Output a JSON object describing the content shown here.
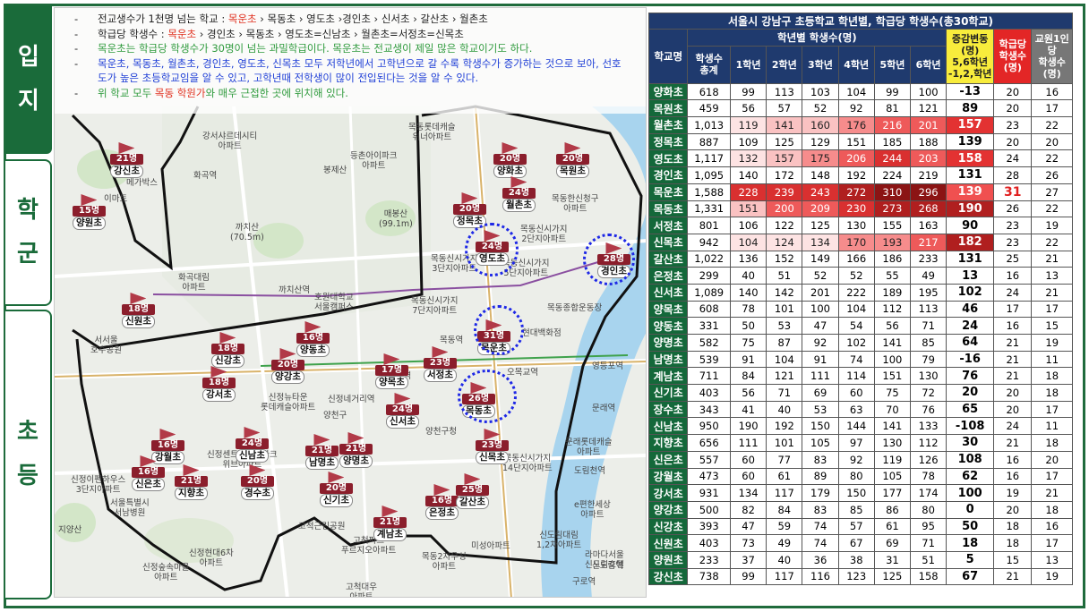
{
  "tabs": [
    {
      "label": "입지",
      "active": true
    },
    {
      "label": "학군",
      "active": false
    },
    {
      "label": "초등",
      "active": false
    }
  ],
  "notes": [
    {
      "parts": [
        {
          "t": "전교생수가 1천명 넘는 학교 : ",
          "c": ""
        },
        {
          "t": "목운초",
          "c": "red"
        },
        {
          "t": " › 목동초 › 영도초 ›경인초 › 신서초 › 갈산초 › 월촌초",
          "c": ""
        }
      ]
    },
    {
      "parts": [
        {
          "t": "학급당 학생수 : ",
          "c": ""
        },
        {
          "t": "목운초",
          "c": "red"
        },
        {
          "t": " › 경인초 › 목동초 › 영도초=신남초 › 월촌초=서정초=신목초",
          "c": ""
        }
      ]
    },
    {
      "parts": [
        {
          "t": "목운초는 학급당 학생수가 30명이 넘는 과밀학급이다. 목운초는 전교생이 제일 많은 학교이기도 하다.",
          "c": "green"
        }
      ]
    },
    {
      "parts": [
        {
          "t": "목운초, 목동초, 월촌초, 경인초, 영도초, 신목초 모두 저학년에서 고학년으로 갈 수록 학생수가 증가하는 것으로 보아, 선호",
          "c": "blue"
        }
      ]
    },
    {
      "parts": [
        {
          "t": "도가 높은 초등학교임을 알 수 있고, 고학년때 전학생이 많이 전입된다는 것을 알 수 있다.",
          "c": "blue"
        }
      ]
    },
    {
      "parts": [
        {
          "t": "위 학교 모두 ",
          "c": "green"
        },
        {
          "t": "목동 학원가",
          "c": "red"
        },
        {
          "t": "와 매우 근접한 곳에 위치해 있다.",
          "c": "green"
        }
      ]
    }
  ],
  "map": {
    "schools": [
      {
        "count": "21명",
        "name": "강신초"
      },
      {
        "count": "15명",
        "name": "양원초"
      },
      {
        "count": "20명",
        "name": "양화초"
      },
      {
        "count": "20명",
        "name": "목원초"
      },
      {
        "count": "24명",
        "name": "월촌초"
      },
      {
        "count": "20명",
        "name": "정목초"
      },
      {
        "count": "24명",
        "name": "영도초"
      },
      {
        "count": "28명",
        "name": "경인초"
      },
      {
        "count": "18명",
        "name": "신원초"
      },
      {
        "count": "18명",
        "name": "신강초"
      },
      {
        "count": "20명",
        "name": "양강초"
      },
      {
        "count": "16명",
        "name": "양동초"
      },
      {
        "count": "31명",
        "name": "목운초"
      },
      {
        "count": "18명",
        "name": "강서초"
      },
      {
        "count": "17명",
        "name": "양목초"
      },
      {
        "count": "23명",
        "name": "서정초"
      },
      {
        "count": "26명",
        "name": "목동초"
      },
      {
        "count": "24명",
        "name": "신서초"
      },
      {
        "count": "16명",
        "name": "강월초"
      },
      {
        "count": "24명",
        "name": "신남초"
      },
      {
        "count": "21명",
        "name": "남명초"
      },
      {
        "count": "21명",
        "name": "양명초"
      },
      {
        "count": "16명",
        "name": "신은초"
      },
      {
        "count": "21명",
        "name": "지향초"
      },
      {
        "count": "20명",
        "name": "경수초"
      },
      {
        "count": "20명",
        "name": "신기초"
      },
      {
        "count": "23명",
        "name": "신목초"
      },
      {
        "count": "16명",
        "name": "은정초"
      },
      {
        "count": "25명",
        "name": "갈산초"
      },
      {
        "count": "21명",
        "name": "계남초"
      }
    ],
    "places": [
      {
        "text": "강서샤르데시티\n아파트"
      },
      {
        "text": "목동롯데캐슬\n위너아파트"
      },
      {
        "text": "등촌아이파크\n아파트"
      },
      {
        "text": "화곡역"
      },
      {
        "text": "봉제산"
      },
      {
        "text": "메가박스"
      },
      {
        "text": "이마트"
      },
      {
        "text": "목동한신청구\n아파트"
      },
      {
        "text": "매봉산\n(99.1m)"
      },
      {
        "text": "까치산\n(70.5m)"
      },
      {
        "text": "목동신시가지\n2단지아파트"
      },
      {
        "text": "목동신시가지\n3단지아파트"
      },
      {
        "text": "목동신시가지\n5단지아파트"
      },
      {
        "text": "화곡대림\n아파트"
      },
      {
        "text": "까치산역"
      },
      {
        "text": "호원대학교\n서울캠퍼스"
      },
      {
        "text": "목동종합운동장"
      },
      {
        "text": "목동신시가지\n7단지아파트"
      },
      {
        "text": "목동역"
      },
      {
        "text": "현대백화점"
      },
      {
        "text": "오목교역"
      },
      {
        "text": "신정역"
      },
      {
        "text": "양천구"
      },
      {
        "text": "신정뉴타운\n롯데캐슬아파트"
      },
      {
        "text": "신정네거리역"
      },
      {
        "text": "양천구청"
      },
      {
        "text": "목동신시가지\n14단지아파트"
      },
      {
        "text": "문래롯데캐슬\n아파트"
      },
      {
        "text": "문래역"
      },
      {
        "text": "도림천역"
      },
      {
        "text": "신정센트럴아이파크\n위브아파트"
      },
      {
        "text": "신정이펜하우스\n3단지아파트"
      },
      {
        "text": "서울특별시\n서남병원"
      },
      {
        "text": "지양산"
      },
      {
        "text": "고척근린공원"
      },
      {
        "text": "고척파크\n푸르지오아파트"
      },
      {
        "text": "신정현대6차\n아파트"
      },
      {
        "text": "신정숲속마을\n아파트"
      },
      {
        "text": "목동2차우성\n아파트"
      },
      {
        "text": "미성아파트"
      },
      {
        "text": "구로역"
      },
      {
        "text": "신도림대림\n1,2차아파트"
      },
      {
        "text": "라마다서울\n신도림호텔"
      },
      {
        "text": "신도림역"
      },
      {
        "text": "고척대우\n아파트"
      },
      {
        "text": "e편한세상\n아파트"
      },
      {
        "text": "서서울\n호수공원"
      },
      {
        "text": "영등포역"
      }
    ]
  },
  "table": {
    "title": "서울시 강남구 초등학교 학년별, 학급당 학생수(총30학교)",
    "headers": {
      "school": "학교명",
      "grade_group": "학년별 학생수(명)",
      "total": "학생수\n총계",
      "grades": [
        "1학년",
        "2학년",
        "3학년",
        "4학년",
        "5학년",
        "6학년"
      ],
      "variation": "증감변동\n(명)\n5,6학년\n-1,2,학년",
      "per_class": "학급당\n학생수\n(명)",
      "per_teacher": "교원1인\n당\n학생수\n(명)"
    },
    "rows": [
      {
        "name": "양화초",
        "total": "618",
        "g": [
          "99",
          "113",
          "103",
          "104",
          "99",
          "100"
        ],
        "var": "-13",
        "cls": "20",
        "tch": "16"
      },
      {
        "name": "목원초",
        "total": "459",
        "g": [
          "56",
          "57",
          "52",
          "92",
          "81",
          "121"
        ],
        "var": "89",
        "cls": "20",
        "tch": "17"
      },
      {
        "name": "월촌초",
        "total": "1,013",
        "g": [
          "119",
          "141",
          "160",
          "176",
          "216",
          "201"
        ],
        "var": "157",
        "cls": "23",
        "tch": "22"
      },
      {
        "name": "정목초",
        "total": "887",
        "g": [
          "109",
          "125",
          "129",
          "151",
          "185",
          "188"
        ],
        "var": "139",
        "cls": "20",
        "tch": "20"
      },
      {
        "name": "영도초",
        "total": "1,117",
        "g": [
          "132",
          "157",
          "175",
          "206",
          "244",
          "203"
        ],
        "var": "158",
        "cls": "24",
        "tch": "22"
      },
      {
        "name": "경인초",
        "total": "1,095",
        "g": [
          "140",
          "172",
          "148",
          "192",
          "224",
          "219"
        ],
        "var": "131",
        "cls": "28",
        "tch": "26"
      },
      {
        "name": "목운초",
        "total": "1,588",
        "g": [
          "228",
          "239",
          "243",
          "272",
          "310",
          "296"
        ],
        "var": "139",
        "cls": "31",
        "tch": "27"
      },
      {
        "name": "목동초",
        "total": "1,331",
        "g": [
          "151",
          "200",
          "209",
          "230",
          "273",
          "268"
        ],
        "var": "190",
        "cls": "26",
        "tch": "22"
      },
      {
        "name": "서정초",
        "total": "801",
        "g": [
          "106",
          "122",
          "125",
          "130",
          "155",
          "163"
        ],
        "var": "90",
        "cls": "23",
        "tch": "19"
      },
      {
        "name": "신목초",
        "total": "942",
        "g": [
          "104",
          "124",
          "134",
          "170",
          "193",
          "217"
        ],
        "var": "182",
        "cls": "23",
        "tch": "22"
      },
      {
        "name": "갈산초",
        "total": "1,022",
        "g": [
          "136",
          "152",
          "149",
          "166",
          "186",
          "233"
        ],
        "var": "131",
        "cls": "25",
        "tch": "21"
      },
      {
        "name": "은정초",
        "total": "299",
        "g": [
          "40",
          "51",
          "52",
          "52",
          "55",
          "49"
        ],
        "var": "13",
        "cls": "16",
        "tch": "13"
      },
      {
        "name": "신서초",
        "total": "1,089",
        "g": [
          "140",
          "142",
          "201",
          "222",
          "189",
          "195"
        ],
        "var": "102",
        "cls": "24",
        "tch": "21"
      },
      {
        "name": "양목초",
        "total": "608",
        "g": [
          "78",
          "101",
          "100",
          "104",
          "112",
          "113"
        ],
        "var": "46",
        "cls": "17",
        "tch": "17"
      },
      {
        "name": "양동초",
        "total": "331",
        "g": [
          "50",
          "53",
          "47",
          "54",
          "56",
          "71"
        ],
        "var": "24",
        "cls": "16",
        "tch": "15"
      },
      {
        "name": "양명초",
        "total": "582",
        "g": [
          "75",
          "87",
          "92",
          "102",
          "141",
          "85"
        ],
        "var": "64",
        "cls": "21",
        "tch": "19"
      },
      {
        "name": "남명초",
        "total": "539",
        "g": [
          "91",
          "104",
          "91",
          "74",
          "100",
          "79"
        ],
        "var": "-16",
        "cls": "21",
        "tch": "11"
      },
      {
        "name": "계남초",
        "total": "711",
        "g": [
          "84",
          "121",
          "111",
          "114",
          "151",
          "130"
        ],
        "var": "76",
        "cls": "21",
        "tch": "18"
      },
      {
        "name": "신기초",
        "total": "403",
        "g": [
          "56",
          "71",
          "69",
          "60",
          "75",
          "72"
        ],
        "var": "20",
        "cls": "20",
        "tch": "18"
      },
      {
        "name": "장수초",
        "total": "343",
        "g": [
          "41",
          "40",
          "53",
          "63",
          "70",
          "76"
        ],
        "var": "65",
        "cls": "20",
        "tch": "17"
      },
      {
        "name": "신남초",
        "total": "950",
        "g": [
          "190",
          "192",
          "150",
          "144",
          "141",
          "133"
        ],
        "var": "-108",
        "cls": "24",
        "tch": "11"
      },
      {
        "name": "지향초",
        "total": "656",
        "g": [
          "111",
          "101",
          "105",
          "97",
          "130",
          "112"
        ],
        "var": "30",
        "cls": "21",
        "tch": "18"
      },
      {
        "name": "신은초",
        "total": "557",
        "g": [
          "60",
          "77",
          "83",
          "92",
          "119",
          "126"
        ],
        "var": "108",
        "cls": "16",
        "tch": "20"
      },
      {
        "name": "강월초",
        "total": "473",
        "g": [
          "60",
          "61",
          "89",
          "80",
          "105",
          "78"
        ],
        "var": "62",
        "cls": "16",
        "tch": "17"
      },
      {
        "name": "강서초",
        "total": "931",
        "g": [
          "134",
          "117",
          "179",
          "150",
          "177",
          "174"
        ],
        "var": "100",
        "cls": "19",
        "tch": "21"
      },
      {
        "name": "양강초",
        "total": "500",
        "g": [
          "82",
          "84",
          "83",
          "85",
          "86",
          "80"
        ],
        "var": "0",
        "cls": "20",
        "tch": "18"
      },
      {
        "name": "신강초",
        "total": "393",
        "g": [
          "47",
          "59",
          "74",
          "57",
          "61",
          "95"
        ],
        "var": "50",
        "cls": "18",
        "tch": "16"
      },
      {
        "name": "신원초",
        "total": "403",
        "g": [
          "73",
          "49",
          "74",
          "67",
          "69",
          "71"
        ],
        "var": "18",
        "cls": "18",
        "tch": "17"
      },
      {
        "name": "양원초",
        "total": "233",
        "g": [
          "37",
          "40",
          "36",
          "38",
          "31",
          "51"
        ],
        "var": "5",
        "cls": "15",
        "tch": "13"
      },
      {
        "name": "강신초",
        "total": "738",
        "g": [
          "99",
          "117",
          "116",
          "123",
          "125",
          "158"
        ],
        "var": "67",
        "cls": "21",
        "tch": "19"
      }
    ],
    "colors": {
      "header_bg": "#1f3a6e",
      "school_name_bg": "#14683a",
      "variation_header_bg": "#f8ec3c",
      "per_class_header_bg": "#e32626",
      "per_teacher_header_bg": "#777777",
      "heat_high": "#9e1b1b",
      "heat_mid": "#e33232",
      "heat_low": "#f7c2c2"
    },
    "highlights": {
      "rows_heat_red": [
        "월촌초",
        "영도초",
        "목운초",
        "목동초",
        "신목초"
      ],
      "variation_red": [
        "월촌초",
        "영도초",
        "목운초",
        "목동초",
        "신목초"
      ],
      "per_class_red": [
        "목운초"
      ]
    }
  }
}
